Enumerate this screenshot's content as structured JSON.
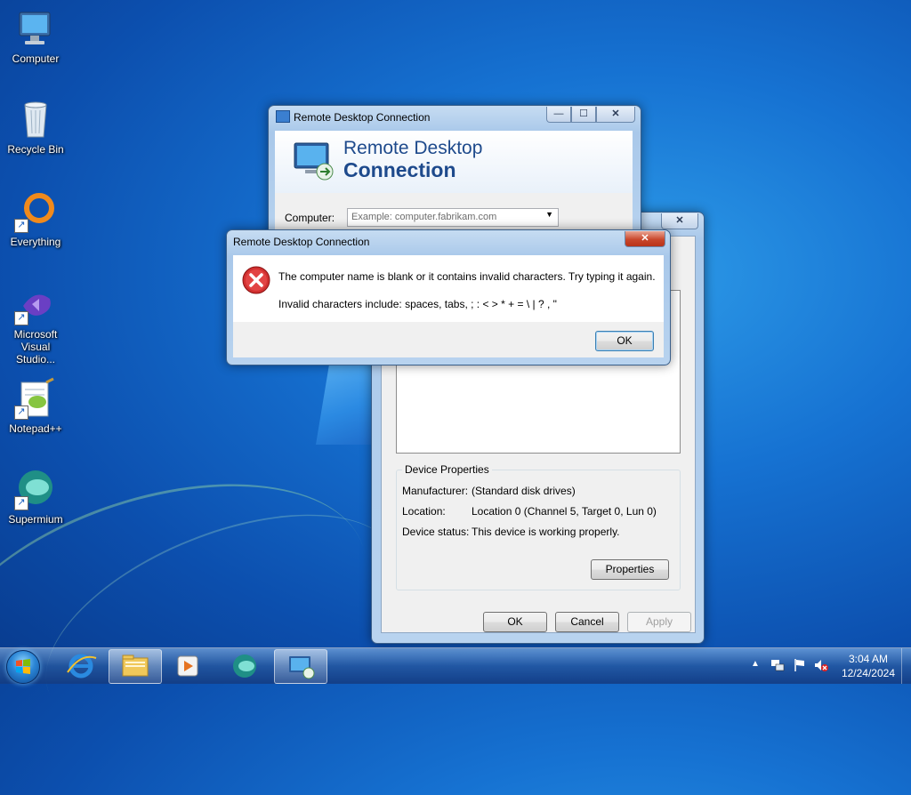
{
  "desktop": {
    "icons": [
      {
        "label": "Computer"
      },
      {
        "label": "Recycle Bin"
      },
      {
        "label": "Everything"
      },
      {
        "label": "Microsoft Visual Studio..."
      },
      {
        "label": "Notepad++"
      },
      {
        "label": "Supermium"
      }
    ]
  },
  "rdc_window": {
    "title": "Remote Desktop Connection",
    "banner_line1": "Remote Desktop",
    "banner_line2": "Connection",
    "computer_label": "Computer:",
    "computer_placeholder": "Example: computer.fabrikam.com"
  },
  "properties_window": {
    "device_properties_group": "Device Properties",
    "manufacturer_label": "Manufacturer:",
    "manufacturer_value": "(Standard disk drives)",
    "location_label": "Location:",
    "location_value": "Location 0 (Channel 5, Target 0, Lun 0)",
    "status_label": "Device status:",
    "status_value": "This device is working properly.",
    "properties_button": "Properties",
    "ok_button": "OK",
    "cancel_button": "Cancel",
    "apply_button": "Apply"
  },
  "error_dialog": {
    "title": "Remote Desktop Connection",
    "message_line1": "The computer name is blank or it contains invalid characters. Try typing it again.",
    "message_line2": "Invalid characters include: spaces, tabs, ; : < > * + = \\ | ? , \"",
    "ok_button": "OK"
  },
  "taskbar": {
    "time": "3:04 AM",
    "date": "12/24/2024"
  }
}
